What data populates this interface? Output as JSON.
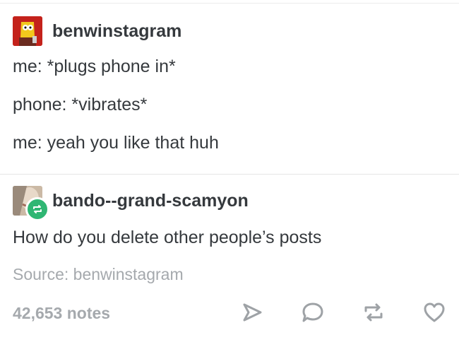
{
  "post1": {
    "username": "benwinstagram",
    "lines": [
      "me: *plugs phone in*",
      "phone: *vibrates*",
      "me: yeah you like that huh"
    ]
  },
  "post2": {
    "username": "bando--grand-scamyon",
    "text": "How do you delete other people’s posts"
  },
  "source": "Source: benwinstagram",
  "notes": "42,653 notes",
  "icons": {
    "share": "share-icon",
    "reply": "reply-icon",
    "reblog": "reblog-icon",
    "like": "heart-icon"
  },
  "colors": {
    "text": "#35393d",
    "muted": "#a5a9ad",
    "reblog_badge": "#2fb673"
  }
}
